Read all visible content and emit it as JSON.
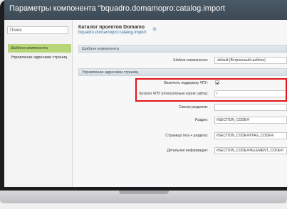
{
  "window": {
    "title": "Параметры компонента \"bquadro.domamopro:catalog.import"
  },
  "sidebar": {
    "search_placeholder": "Поиск",
    "items": [
      {
        "label": "Шаблон компонента",
        "active": true
      },
      {
        "label": "Управление адресами страниц",
        "active": false
      }
    ]
  },
  "main": {
    "title": "Каталог проектов Domamo",
    "subtitle": "bquadro.domamopro:catalog.import",
    "info_icon": "i",
    "sections": {
      "template": "Шаблон компонента",
      "urls": "Управление адресами страниц"
    },
    "fields": {
      "template": {
        "label": "Шаблон компонента:",
        "value": ".default (Встроенный шаблон)"
      },
      "sef": {
        "label": "Включить поддержку ЧПУ:",
        "checked": true
      },
      "sef_folder": {
        "label": "Каталог ЧПУ (относительно корня сайта):",
        "value": "/"
      },
      "sections_list": {
        "label": "Список разделов:",
        "value": ""
      },
      "section": {
        "label": "Раздел:",
        "value": "#SECTION_CODE#/"
      },
      "tag_page": {
        "label": "Страница тега + раздела:",
        "value": "#SECTION_CODE#/#TAG_CODE#/"
      },
      "detail": {
        "label": "Детальная информация:",
        "value": "#SECTION_CODE#/#ELEMENT_CODE#/"
      }
    }
  },
  "highlight_color": "#e2151a",
  "accent_color": "#b9d57a"
}
